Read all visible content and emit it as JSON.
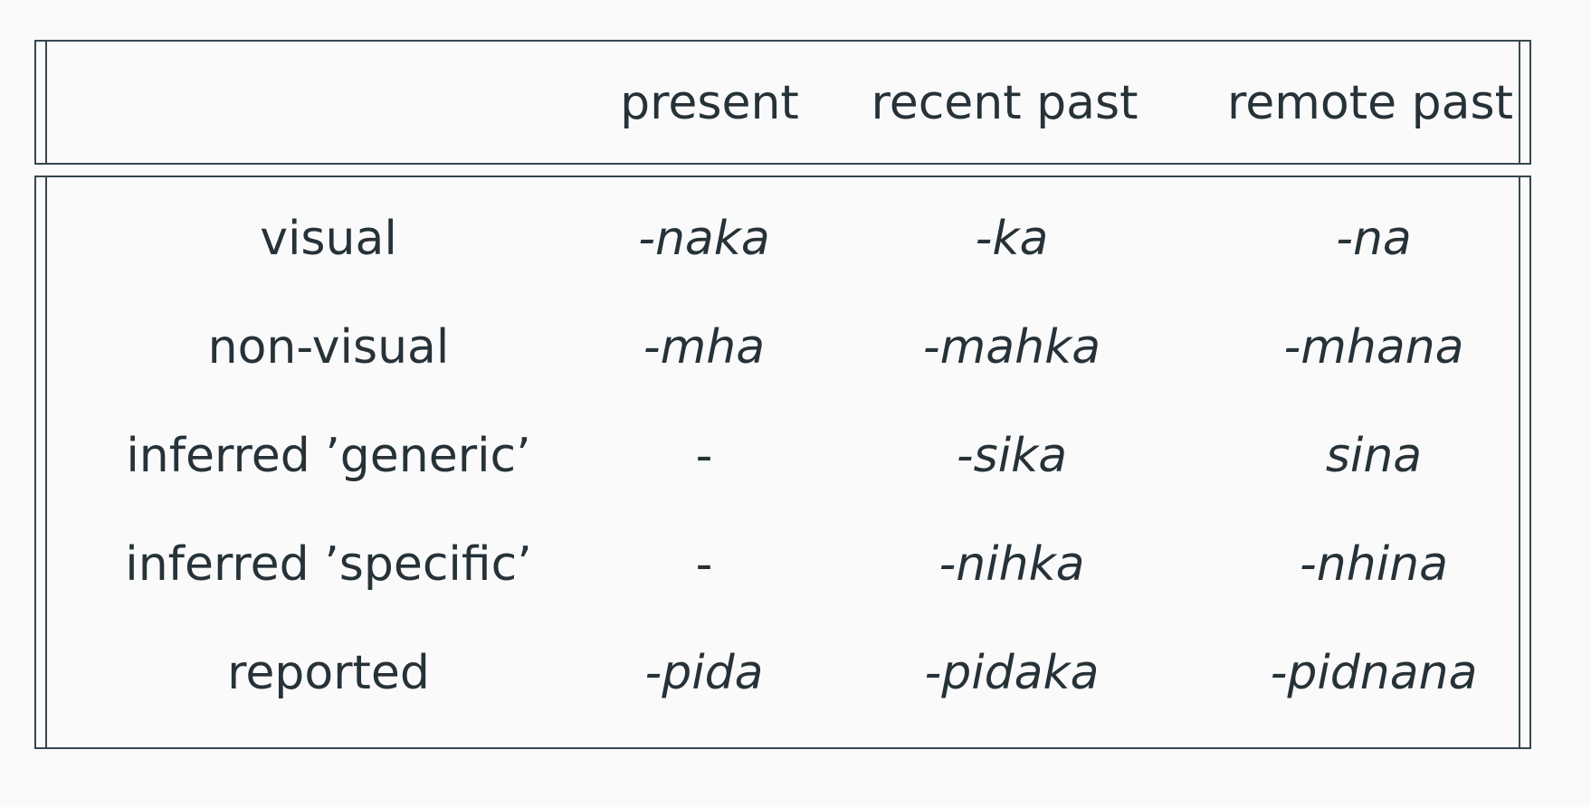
{
  "table": {
    "headers": [
      "",
      "present",
      "recent past",
      "remote past"
    ],
    "rows": [
      {
        "label": "visual",
        "present": "-naka",
        "recent": "-ka",
        "remote": "-na"
      },
      {
        "label": "non-visual",
        "present": "-mha",
        "recent": "-mahka",
        "remote": "-mhana"
      },
      {
        "label": "inferred ’generic’",
        "present": "-",
        "recent": "-sika",
        "remote": "sina"
      },
      {
        "label": "inferred ’specific’",
        "present": "-",
        "recent": "-nihka",
        "remote": "-nhina"
      },
      {
        "label": "reported",
        "present": "-pida",
        "recent": "-pidaka",
        "remote": "-pidnana"
      }
    ]
  }
}
